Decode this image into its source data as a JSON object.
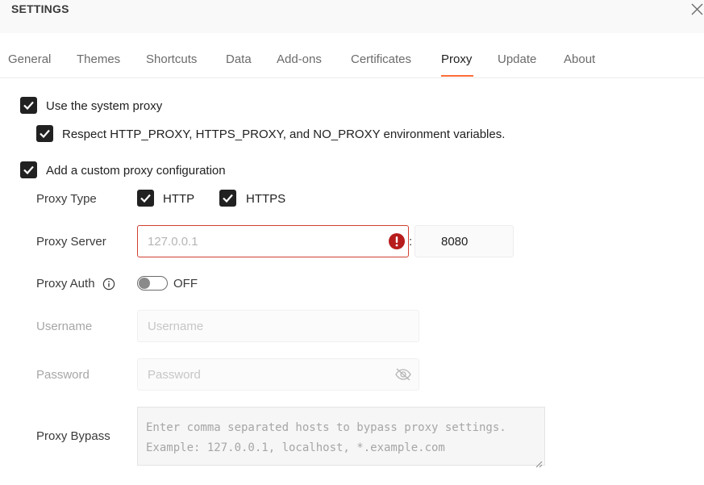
{
  "header": {
    "title": "SETTINGS"
  },
  "tabs": [
    {
      "label": "General"
    },
    {
      "label": "Themes"
    },
    {
      "label": "Shortcuts"
    },
    {
      "label": "Data"
    },
    {
      "label": "Add-ons"
    },
    {
      "label": "Certificates"
    },
    {
      "label": "Proxy",
      "active": true
    },
    {
      "label": "Update"
    },
    {
      "label": "About"
    }
  ],
  "proxy": {
    "system_proxy": {
      "label": "Use the system proxy",
      "checked": true
    },
    "env_vars": {
      "label": "Respect HTTP_PROXY, HTTPS_PROXY, and NO_PROXY environment variables.",
      "checked": true
    },
    "custom": {
      "label": "Add a custom proxy configuration",
      "checked": true
    },
    "type": {
      "label": "Proxy Type",
      "http": {
        "label": "HTTP",
        "checked": true
      },
      "https": {
        "label": "HTTPS",
        "checked": true
      }
    },
    "server": {
      "label": "Proxy Server",
      "host_placeholder": "127.0.0.1",
      "separator": ":",
      "port": "8080"
    },
    "auth": {
      "label": "Proxy Auth",
      "toggle_state": "OFF"
    },
    "username": {
      "label": "Username",
      "placeholder": "Username"
    },
    "password": {
      "label": "Password",
      "placeholder": "Password"
    },
    "bypass": {
      "label": "Proxy Bypass",
      "placeholder_line1": "Enter comma separated hosts to bypass proxy settings.",
      "placeholder_line2": "Example: 127.0.0.1, localhost, *.example.com"
    }
  },
  "colors": {
    "accent": "#ff6c37",
    "error": "#d23f31",
    "checkbox": "#212121"
  }
}
